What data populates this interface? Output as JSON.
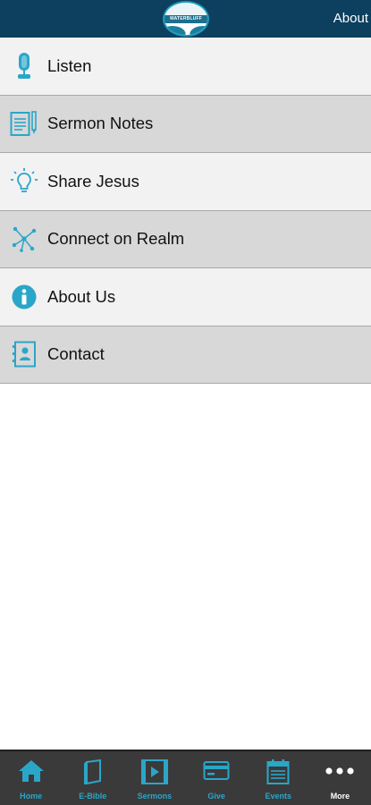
{
  "header": {
    "logo_text": "WATERBLUFF",
    "action_label": "About"
  },
  "menu": {
    "items": [
      {
        "label": "Listen",
        "icon": "microphone-icon"
      },
      {
        "label": "Sermon Notes",
        "icon": "notes-icon"
      },
      {
        "label": "Share Jesus",
        "icon": "lightbulb-icon"
      },
      {
        "label": "Connect on Realm",
        "icon": "network-icon"
      },
      {
        "label": "About Us",
        "icon": "info-icon"
      },
      {
        "label": "Contact",
        "icon": "contact-book-icon"
      }
    ]
  },
  "tabbar": {
    "tabs": [
      {
        "label": "Home",
        "icon": "home-icon"
      },
      {
        "label": "E-Bible",
        "icon": "bible-icon"
      },
      {
        "label": "Sermons",
        "icon": "video-icon"
      },
      {
        "label": "Give",
        "icon": "credit-card-icon"
      },
      {
        "label": "Events",
        "icon": "calendar-icon"
      },
      {
        "label": "More",
        "icon": "more-dots-icon",
        "active": true
      }
    ]
  },
  "colors": {
    "header_bg": "#0d3f5f",
    "accent": "#2aa6c9",
    "row_light": "#f2f2f2",
    "row_dark": "#d8d8d8",
    "tabbar_bg": "#3a3a3a"
  }
}
